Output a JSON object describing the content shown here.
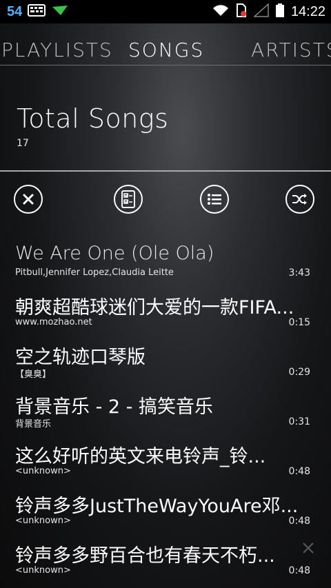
{
  "status_bar": {
    "left_number": "54",
    "time": "14:22",
    "icons": [
      "keyboard-icon",
      "download-arrow-icon",
      "wifi-icon",
      "sim-alert-icon",
      "signal-icon",
      "battery-icon"
    ]
  },
  "tabs": [
    {
      "label": "Playlists",
      "active": false
    },
    {
      "label": "Songs",
      "active": true
    },
    {
      "label": "Artists",
      "active": false
    }
  ],
  "header": {
    "title": "Total Songs",
    "count": "17"
  },
  "toolbar": {
    "buttons": [
      "close-icon",
      "checklist-icon",
      "list-icon",
      "shuffle-icon"
    ]
  },
  "songs": [
    {
      "title": "We Are One (Ole Ola)",
      "artist": "Pitbull,Jennifer Lopez,Claudia Leitte",
      "duration": "3:43"
    },
    {
      "title": "朝爽超酷球迷们大爱的一款FIFA...",
      "artist": "www.mozhao.net",
      "duration": "0:15"
    },
    {
      "title": "空之轨迹口琴版",
      "artist": "【臭臭】",
      "duration": "0:29"
    },
    {
      "title": "背景音乐 - 2 - 搞笑音乐",
      "artist": "背景音乐",
      "duration": "0:31"
    },
    {
      "title": "这么好听的英文来电铃声_铃...",
      "artist": "<unknown>",
      "duration": "0:48"
    },
    {
      "title": "铃声多多JustTheWayYouAre邓...",
      "artist": "<unknown>",
      "duration": "0:48"
    },
    {
      "title": "铃声多多野百合也有春天不朽...",
      "artist": "<unknown>",
      "duration": "0:48"
    }
  ]
}
